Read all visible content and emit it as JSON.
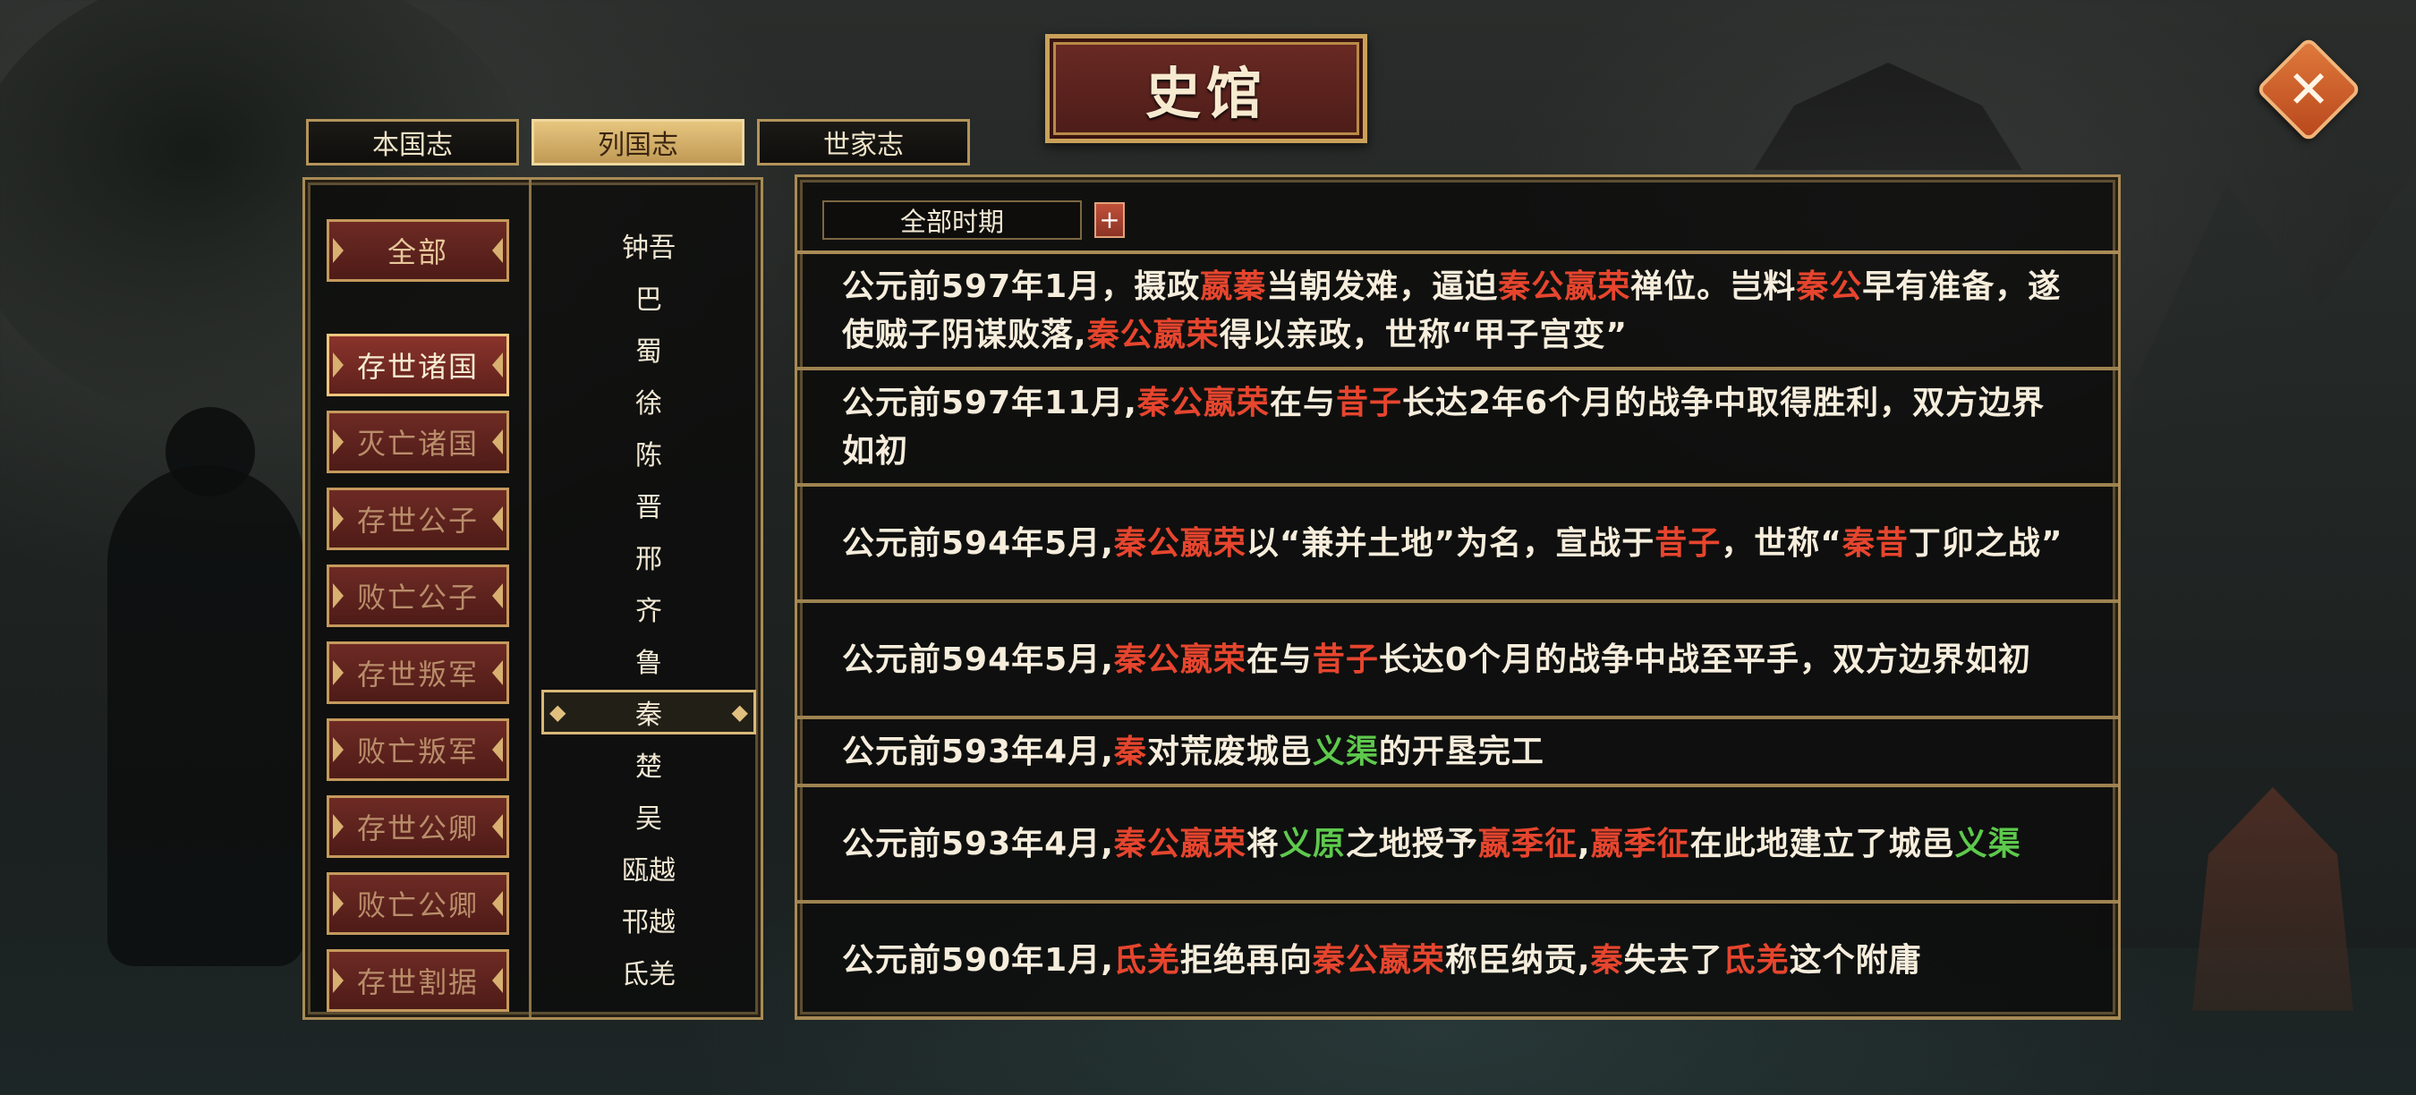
{
  "title": "史馆",
  "tabs": [
    {
      "label": "本国志",
      "active": false
    },
    {
      "label": "列国志",
      "active": true
    },
    {
      "label": "世家志",
      "active": false
    }
  ],
  "categories": [
    {
      "label": "全部"
    },
    {
      "label": "存世诸国"
    },
    {
      "label": "灭亡诸国"
    },
    {
      "label": "存世公子"
    },
    {
      "label": "败亡公子"
    },
    {
      "label": "存世叛军"
    },
    {
      "label": "败亡叛军"
    },
    {
      "label": "存世公卿"
    },
    {
      "label": "败亡公卿"
    },
    {
      "label": "存世割据"
    }
  ],
  "nations": [
    "钟吾",
    "巴",
    "蜀",
    "徐",
    "陈",
    "晋",
    "邢",
    "齐",
    "鲁",
    "秦",
    "楚",
    "吴",
    "瓯越",
    "邗越",
    "氐羌"
  ],
  "selected_nation": "秦",
  "filter": {
    "period": "全部时期",
    "plus": "+"
  },
  "colors": {
    "highlight_red": "#e6452e",
    "highlight_green": "#5ec94d",
    "gold_border": "#a98b55",
    "text": "#f6eddc"
  },
  "icons": {
    "close": "close-icon"
  },
  "records": [
    {
      "segments": [
        {
          "t": "公元前597年1月，摄政",
          "c": ""
        },
        {
          "t": "嬴蓁",
          "c": "red"
        },
        {
          "t": "当朝发难，逼迫",
          "c": ""
        },
        {
          "t": "秦公嬴荣",
          "c": "red"
        },
        {
          "t": "禅位。岂料",
          "c": ""
        },
        {
          "t": "秦公",
          "c": "red"
        },
        {
          "t": "早有准备，遂使贼子阴谋败落,",
          "c": ""
        },
        {
          "t": "秦公嬴荣",
          "c": "red"
        },
        {
          "t": "得以亲政，世称“甲子宫变”",
          "c": ""
        }
      ]
    },
    {
      "segments": [
        {
          "t": "公元前597年11月,",
          "c": ""
        },
        {
          "t": "秦公嬴荣",
          "c": "red"
        },
        {
          "t": "在与",
          "c": ""
        },
        {
          "t": "昔子",
          "c": "red"
        },
        {
          "t": "长达2年6个月的战争中取得胜利，双方边界如初",
          "c": ""
        }
      ]
    },
    {
      "segments": [
        {
          "t": "公元前594年5月,",
          "c": ""
        },
        {
          "t": "秦公嬴荣",
          "c": "red"
        },
        {
          "t": "以“兼并土地”为名，宣战于",
          "c": ""
        },
        {
          "t": "昔子",
          "c": "red"
        },
        {
          "t": "，世称“",
          "c": ""
        },
        {
          "t": "秦昔",
          "c": "red"
        },
        {
          "t": "丁卯之战”",
          "c": ""
        }
      ]
    },
    {
      "segments": [
        {
          "t": "公元前594年5月,",
          "c": ""
        },
        {
          "t": "秦公嬴荣",
          "c": "red"
        },
        {
          "t": "在与",
          "c": ""
        },
        {
          "t": "昔子",
          "c": "red"
        },
        {
          "t": "长达0个月的战争中战至平手，双方边界如初",
          "c": ""
        }
      ]
    },
    {
      "segments": [
        {
          "t": "公元前593年4月,",
          "c": ""
        },
        {
          "t": "秦",
          "c": "red"
        },
        {
          "t": "对荒废城邑",
          "c": ""
        },
        {
          "t": "义渠",
          "c": "green"
        },
        {
          "t": "的开垦完工",
          "c": ""
        }
      ]
    },
    {
      "segments": [
        {
          "t": "公元前593年4月,",
          "c": ""
        },
        {
          "t": "秦公嬴荣",
          "c": "red"
        },
        {
          "t": "将",
          "c": ""
        },
        {
          "t": "义原",
          "c": "green"
        },
        {
          "t": "之地授予",
          "c": ""
        },
        {
          "t": "嬴季征",
          "c": "red"
        },
        {
          "t": ",",
          "c": ""
        },
        {
          "t": "嬴季征",
          "c": "red"
        },
        {
          "t": "在此地建立了城邑",
          "c": ""
        },
        {
          "t": "义渠",
          "c": "green"
        }
      ]
    },
    {
      "segments": [
        {
          "t": "公元前590年1月,",
          "c": ""
        },
        {
          "t": "氐羌",
          "c": "red"
        },
        {
          "t": "拒绝再向",
          "c": ""
        },
        {
          "t": "秦公嬴荣",
          "c": "red"
        },
        {
          "t": "称臣纳贡,",
          "c": ""
        },
        {
          "t": "秦",
          "c": "red"
        },
        {
          "t": "失去了",
          "c": ""
        },
        {
          "t": "氐羌",
          "c": "red"
        },
        {
          "t": "这个附庸",
          "c": ""
        }
      ]
    }
  ]
}
